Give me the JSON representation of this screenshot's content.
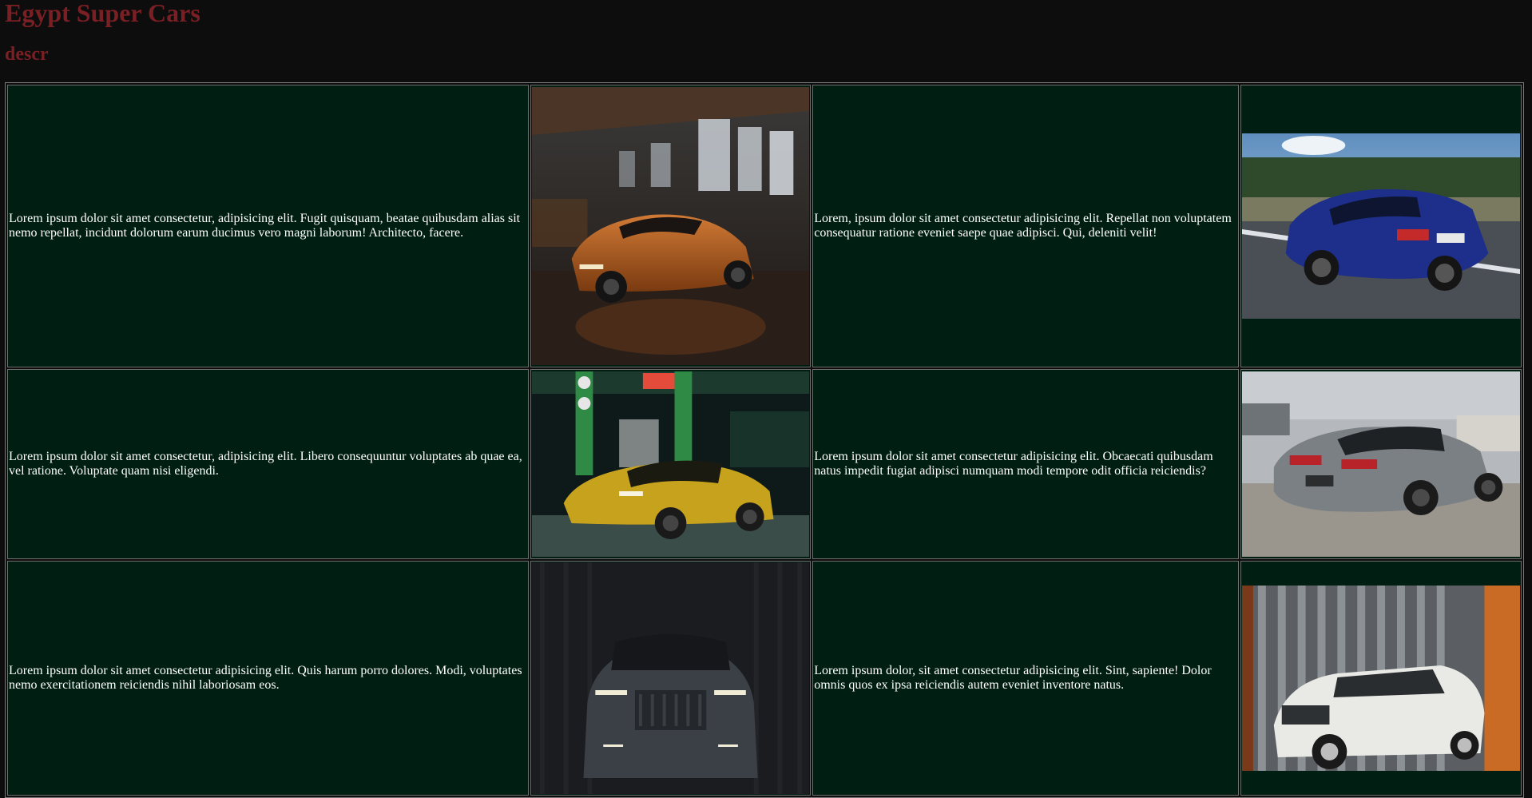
{
  "header": {
    "title": "Egypt Super Cars",
    "subtitle": "descr"
  },
  "rows": [
    {
      "text_a": "Lorem ipsum dolor sit amet consectetur, adipisicing elit. Fugit quisquam, beatae quibusdam alias sit nemo repellat, incidunt dolorum earum ducimus vero magni laborum! Architecto, facere.",
      "image_a": "orange-sports-car-in-warehouse",
      "text_b": "Lorem, ipsum dolor sit amet consectetur adipisicing elit. Repellat non voluptatem consequatur ratione eveniet saepe quae adipisci. Qui, deleniti velit!",
      "image_b": "blue-coupe-on-road"
    },
    {
      "text_a": "Lorem ipsum dolor sit amet consectetur, adipisicing elit. Libero consequuntur voluptates ab quae ea, vel ratione. Voluptate quam nisi eligendi.",
      "image_a": "yellow-sedan-at-gas-station",
      "text_b": "Lorem ipsum dolor sit amet consectetur adipisicing elit. Obcaecati quibusdam natus impedit fugiat adipisci numquam modi tempore odit officia reiciendis?",
      "image_b": "grey-sedan-at-harbor"
    },
    {
      "text_a": "Lorem ipsum dolor sit amet consectetur adipisicing elit. Quis harum porro dolores. Modi, voluptates nemo exercitationem reiciendis nihil laboriosam eos.",
      "image_a": "dark-suv-front-view",
      "text_b": "Lorem ipsum dolor, sit amet consectetur adipisicing elit. Sint, sapiente! Dolor omnis quos ex ipsa reiciendis autem eveniet inventore natus.",
      "image_b": "white-suv-by-containers"
    }
  ],
  "colors": {
    "page_bg": "#0d0d0d",
    "heading": "#7a1f24",
    "cell_bg": "#001f12"
  }
}
